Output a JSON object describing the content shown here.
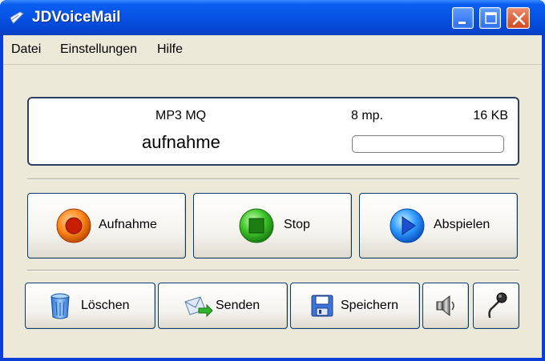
{
  "window": {
    "title": "JDVoiceMail"
  },
  "menu": [
    {
      "label": "Datei"
    },
    {
      "label": "Einstellungen"
    },
    {
      "label": "Hilfe"
    }
  ],
  "status": {
    "format": "MP3 MQ",
    "filename": "aufnahme",
    "duration": "8 mp.",
    "size": "16 KB",
    "progress": 0
  },
  "buttons": {
    "record": "Aufnahme",
    "stop": "Stop",
    "play": "Abspielen",
    "delete": "Löschen",
    "send": "Senden",
    "save": "Speichern"
  },
  "icons": {
    "record": "record-icon",
    "stop": "stop-icon",
    "play": "play-icon",
    "delete": "trash-icon",
    "send": "envelope-send-icon",
    "save": "floppy-disk-icon",
    "speaker": "speaker-icon",
    "microphone": "microphone-icon"
  },
  "colors": {
    "titlebar": "#0654e6",
    "face": "#ece9d8",
    "record": "#cc2a00",
    "stop": "#2da51e",
    "play": "#1a66e0"
  }
}
